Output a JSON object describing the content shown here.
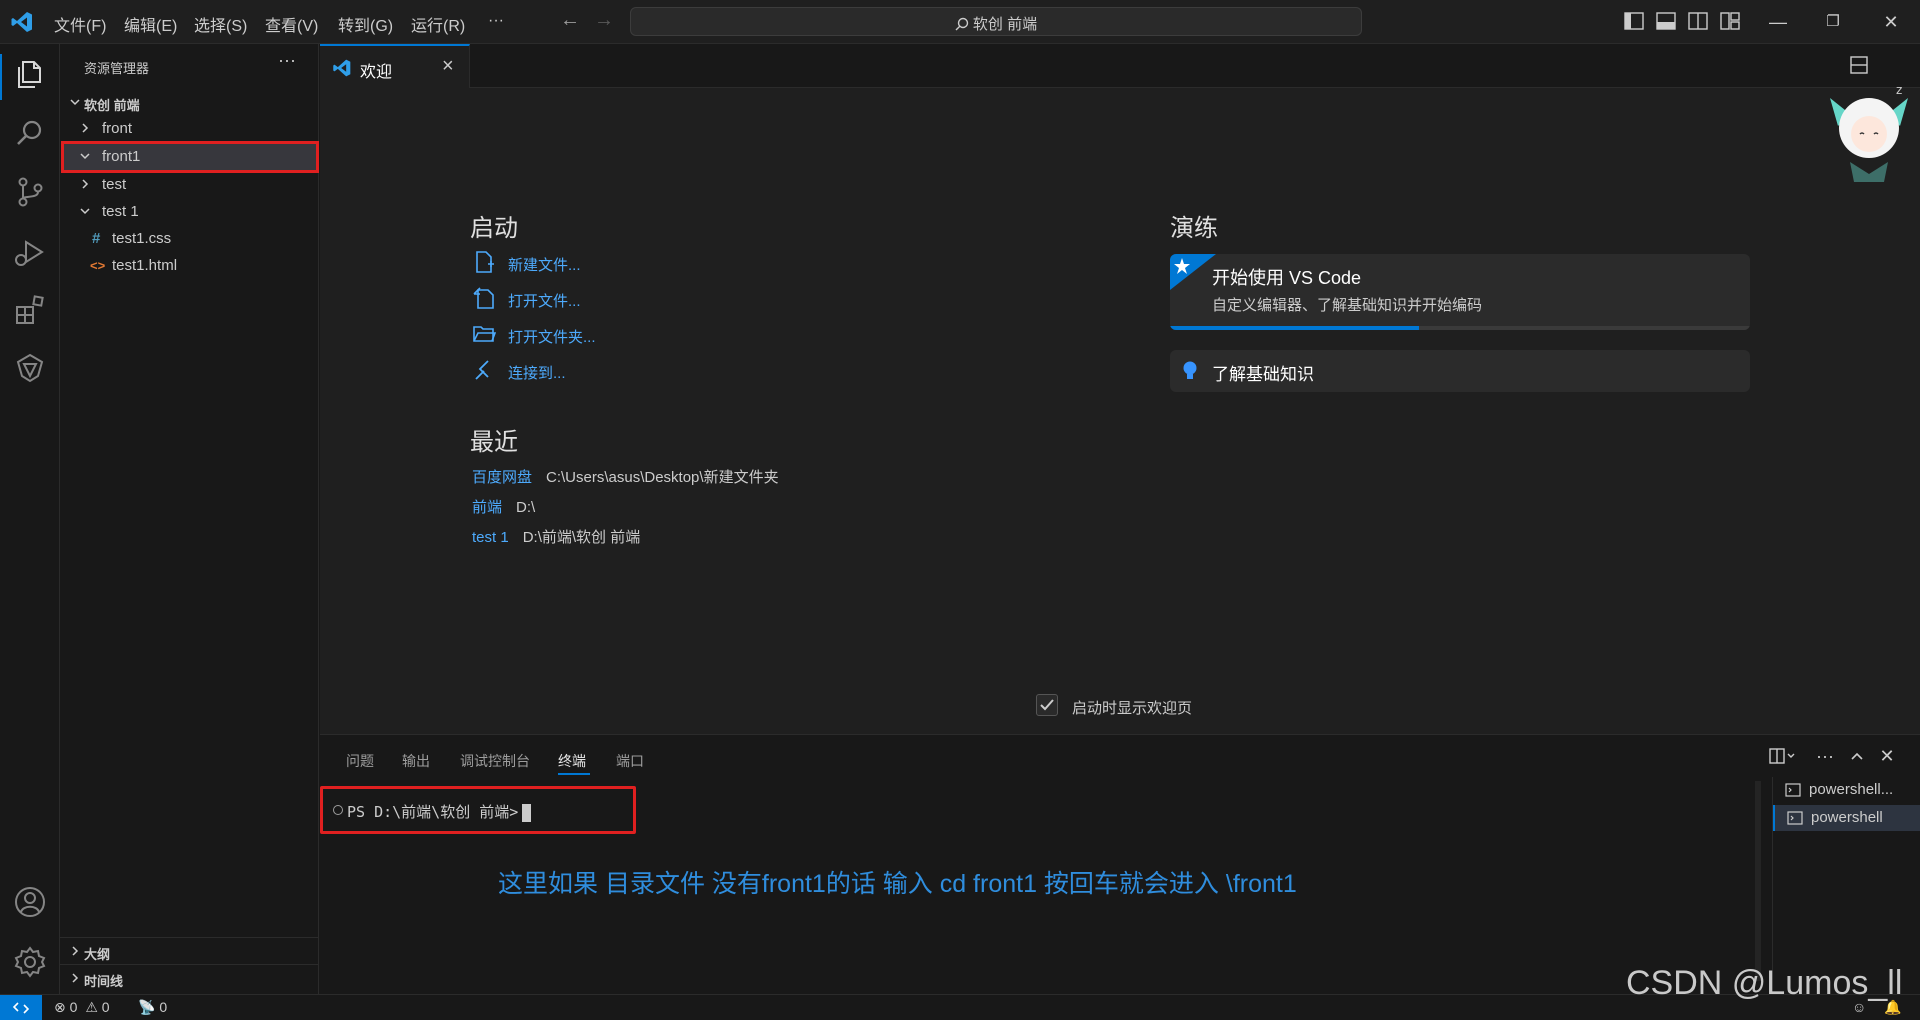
{
  "titlebar": {
    "menus": [
      "文件(F)",
      "编辑(E)",
      "选择(S)",
      "查看(V)",
      "转到(G)",
      "运行(R)",
      "···"
    ],
    "search_text": "软创 前端"
  },
  "sidebar": {
    "title": "资源管理器",
    "more": "···",
    "root": "软创 前端",
    "items": [
      {
        "label": "front",
        "type": "folder",
        "expanded": false
      },
      {
        "label": "front1",
        "type": "folder",
        "expanded": true,
        "selected": true
      },
      {
        "label": "test",
        "type": "folder",
        "expanded": false
      },
      {
        "label": "test 1",
        "type": "folder",
        "expanded": true
      },
      {
        "label": "test1.css",
        "type": "css-file",
        "icon": "#"
      },
      {
        "label": "test1.html",
        "type": "html-file",
        "icon": "<>"
      }
    ],
    "outline": "大纲",
    "timeline": "时间线"
  },
  "tab": {
    "label": "欢迎",
    "close": "×"
  },
  "welcome": {
    "start_heading": "启动",
    "start_items": [
      {
        "label": "新建文件...",
        "icon": "new-file-icon"
      },
      {
        "label": "打开文件...",
        "icon": "open-file-icon"
      },
      {
        "label": "打开文件夹...",
        "icon": "open-folder-icon"
      },
      {
        "label": "连接到...",
        "icon": "remote-connect-icon"
      }
    ],
    "recent_heading": "最近",
    "recent": [
      {
        "name": "百度网盘",
        "path": "C:\\Users\\asus\\Desktop\\新建文件夹"
      },
      {
        "name": "前端",
        "path": "D:\\"
      },
      {
        "name": "test 1",
        "path": "D:\\前端\\软创 前端"
      }
    ],
    "walkthrough_heading": "演练",
    "walkthrough": {
      "title": "开始使用 VS Code",
      "desc": "自定义编辑器、了解基础知识并开始编码",
      "progress": 0.43
    },
    "learn": "了解基础知识",
    "show_on_startup": "启动时显示欢迎页",
    "show_on_startup_checked": true
  },
  "panel": {
    "tabs": [
      "问题",
      "输出",
      "调试控制台",
      "终端",
      "端口"
    ],
    "active_tab": "终端",
    "prompt": "PS D:\\前端\\软创 前端>",
    "annotation": "这里如果 目录文件 没有front1的话 输入 cd front1  按回车就会进入 \\front1",
    "terminals": [
      "powershell...",
      "powershell"
    ]
  },
  "statusbar": {
    "errors": "0",
    "warnings": "0",
    "ports": "0"
  },
  "watermark": "CSDN @Lumos_ll",
  "colors": {
    "accent": "#0078d4",
    "link": "#4daafc",
    "highlight_box": "#e02020",
    "annotation": "#2f8ddd"
  }
}
